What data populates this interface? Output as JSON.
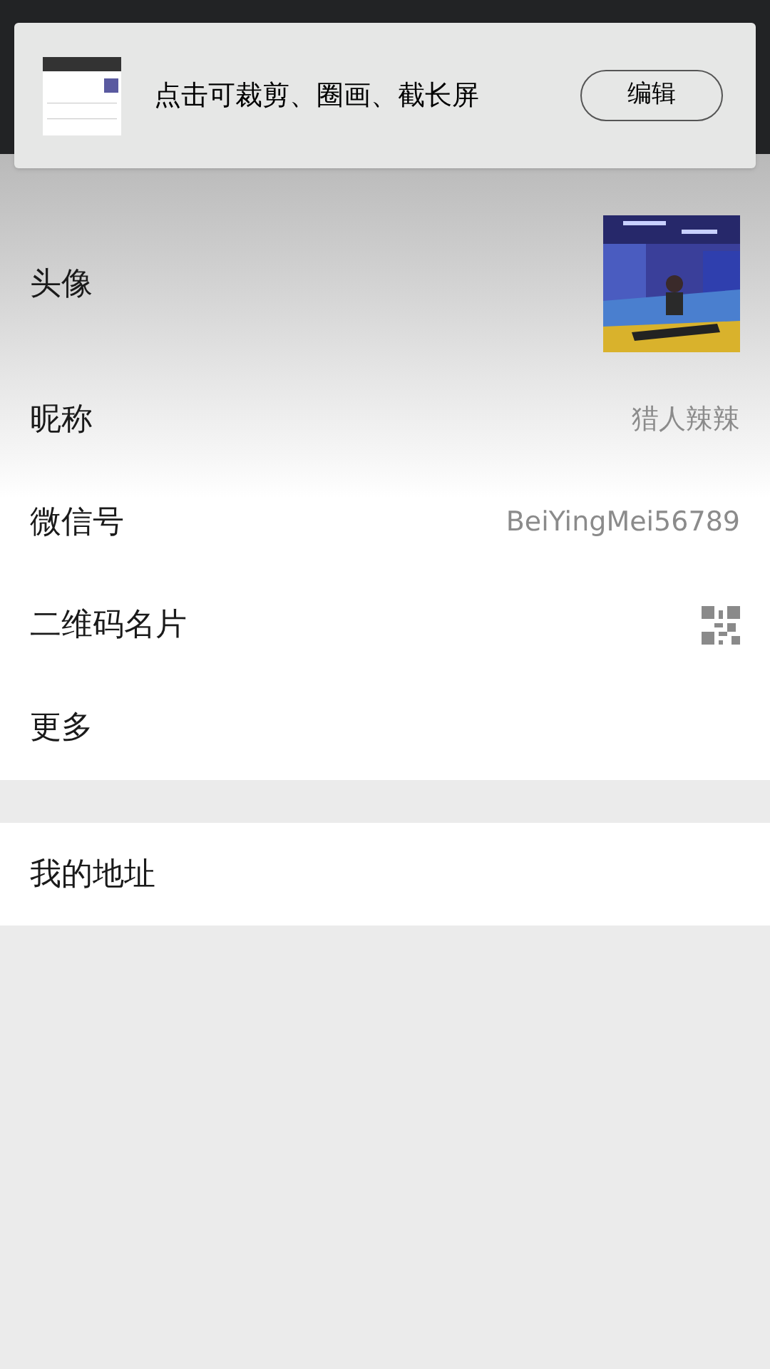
{
  "screenshot_banner": {
    "hint": "点击可裁剪、圈画、截长屏",
    "edit_button": "编辑"
  },
  "profile_rows": [
    {
      "label": "头像",
      "kind": "avatar"
    },
    {
      "label": "昵称",
      "kind": "text",
      "value": "猎人辣辣"
    },
    {
      "label": "微信号",
      "kind": "text",
      "value": "BeiYingMei56789"
    },
    {
      "label": "二维码名片",
      "kind": "qr"
    },
    {
      "label": "更多"
    }
  ],
  "address_rows": [
    {
      "label": "我的地址"
    }
  ]
}
